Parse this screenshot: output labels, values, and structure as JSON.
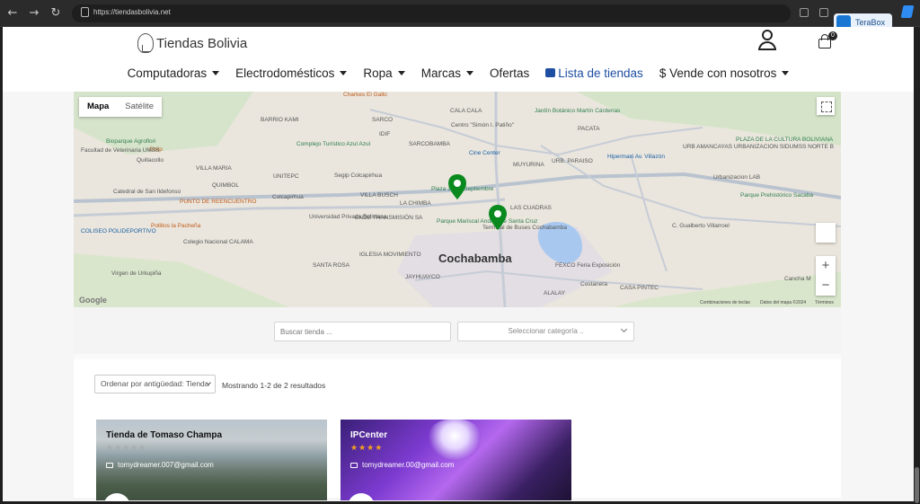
{
  "browser": {
    "url": "https://tiendasbolivia.net",
    "extension_label": "TeraBox"
  },
  "site": {
    "logo_text": "Tiendas Bolivia",
    "cart_count": "0"
  },
  "menu": [
    {
      "label": "Computadoras",
      "caret": true
    },
    {
      "label": "Electrodomésticos",
      "caret": true
    },
    {
      "label": "Ropa",
      "caret": true
    },
    {
      "label": "Marcas",
      "caret": true
    },
    {
      "label": "Ofertas",
      "caret": false
    },
    {
      "label": "Lista de tiendas",
      "caret": false,
      "active": true
    },
    {
      "label": "$ Vende con nosotros",
      "caret": true
    }
  ],
  "map": {
    "tab_map": "Mapa",
    "tab_satellite": "Satélite",
    "zoom_in": "+",
    "zoom_out": "−",
    "google_label": "Google",
    "shortcuts": "Combinaciones de teclas",
    "map_data": "Datos del mapa ©2024",
    "terms": "Términos",
    "city_label": "Cochabamba",
    "places": [
      {
        "text": "Charkes El Gallo",
        "cls": "org"
      },
      {
        "text": "BARRIO KAMI",
        "cls": ""
      },
      {
        "text": "SARCO",
        "cls": ""
      },
      {
        "text": "IDIF",
        "cls": ""
      },
      {
        "text": "SARCOBAMBA",
        "cls": ""
      },
      {
        "text": "CALA CALA",
        "cls": ""
      },
      {
        "text": "Centro \"Simón I. Patiño\"",
        "cls": ""
      },
      {
        "text": "Jardín Botánico Martín Cárdenas",
        "cls": "grn"
      },
      {
        "text": "PACATA",
        "cls": ""
      },
      {
        "text": "Bioparque Agroflori",
        "cls": "grn"
      },
      {
        "text": "Chiip",
        "cls": "org"
      },
      {
        "text": "Facultad de Veterinaria UMSS",
        "cls": ""
      },
      {
        "text": "Complejo Turístico Azul Azul",
        "cls": "grn"
      },
      {
        "text": "Cine Center",
        "cls": "blu"
      },
      {
        "text": "MUYURINA",
        "cls": ""
      },
      {
        "text": "URB. PARAISO",
        "cls": ""
      },
      {
        "text": "Hipermaxi Av. Villazón",
        "cls": "blu"
      },
      {
        "text": "PLAZA DE LA CULTURA BOLIVIANA",
        "cls": "grn"
      },
      {
        "text": "URB AMANCAYAS URBANIZACION SIDUMSS NORTE B",
        "cls": ""
      },
      {
        "text": "Quillacollo",
        "cls": ""
      },
      {
        "text": "VILLA MARIA",
        "cls": ""
      },
      {
        "text": "UNITEPC",
        "cls": ""
      },
      {
        "text": "Segip Colcapirhua",
        "cls": ""
      },
      {
        "text": "Plaza 14 de Septiembre",
        "cls": "grn"
      },
      {
        "text": "Urbanizacion LAB",
        "cls": ""
      },
      {
        "text": "QUIMBOL",
        "cls": ""
      },
      {
        "text": "Catedral de San Ildefonso",
        "cls": ""
      },
      {
        "text": "Colcapirhua",
        "cls": ""
      },
      {
        "text": "VILLA BUSCH",
        "cls": ""
      },
      {
        "text": "Parque Prehistórico Sacaba",
        "cls": "grn"
      },
      {
        "text": "PUNTO DE REENCUENTRO",
        "cls": "org"
      },
      {
        "text": "LA CHIMBA",
        "cls": ""
      },
      {
        "text": "LAS CUADRAS",
        "cls": ""
      },
      {
        "text": "Universidad Privada Boliviana",
        "cls": ""
      },
      {
        "text": "ENDE TRANSMISIÓN SA",
        "cls": ""
      },
      {
        "text": "Parque Mariscal Andrés de Santa Cruz",
        "cls": "grn"
      },
      {
        "text": "Terminal de Buses Cochabamba",
        "cls": ""
      },
      {
        "text": "C. Gualberto Villarroel",
        "cls": ""
      },
      {
        "text": "COLISEO POLIDEPORTIVO",
        "cls": "blu"
      },
      {
        "text": "Pollitos la Pacheña",
        "cls": "org"
      },
      {
        "text": "Colegio Nacional CALAMA",
        "cls": ""
      },
      {
        "text": "SANTA ROSA",
        "cls": ""
      },
      {
        "text": "IGLESIA MOVIMIENTO",
        "cls": ""
      },
      {
        "text": "FEXCO Feria Exposición",
        "cls": ""
      },
      {
        "text": "Virgen de Urkupiña",
        "cls": ""
      },
      {
        "text": "JAYHUAYCO",
        "cls": ""
      },
      {
        "text": "ALALAY",
        "cls": ""
      },
      {
        "text": "CASA PINTEC",
        "cls": ""
      },
      {
        "text": "Cancha M",
        "cls": ""
      },
      {
        "text": "Costanera",
        "cls": ""
      }
    ]
  },
  "filters": {
    "search_placeholder": "Buscar tienda ...",
    "category_placeholder": "Seleccionar categoría .."
  },
  "results": {
    "order_label": "Ordenar por antigüedad: Tienda",
    "count_text": "Mostrando 1-2 de 2 resultados",
    "stores": [
      {
        "name": "Tienda de Tomaso Champa",
        "stars": "★★★★★",
        "email": "tomydreamer.007@gmail.com",
        "rating": 0
      },
      {
        "name": "IPCenter",
        "stars": "★★★★",
        "email": "tomydreamer.00@gmail.com",
        "rating": 4
      }
    ]
  },
  "colors": {
    "accent": "#1e4ea1",
    "pin": "#0a8a1e"
  }
}
